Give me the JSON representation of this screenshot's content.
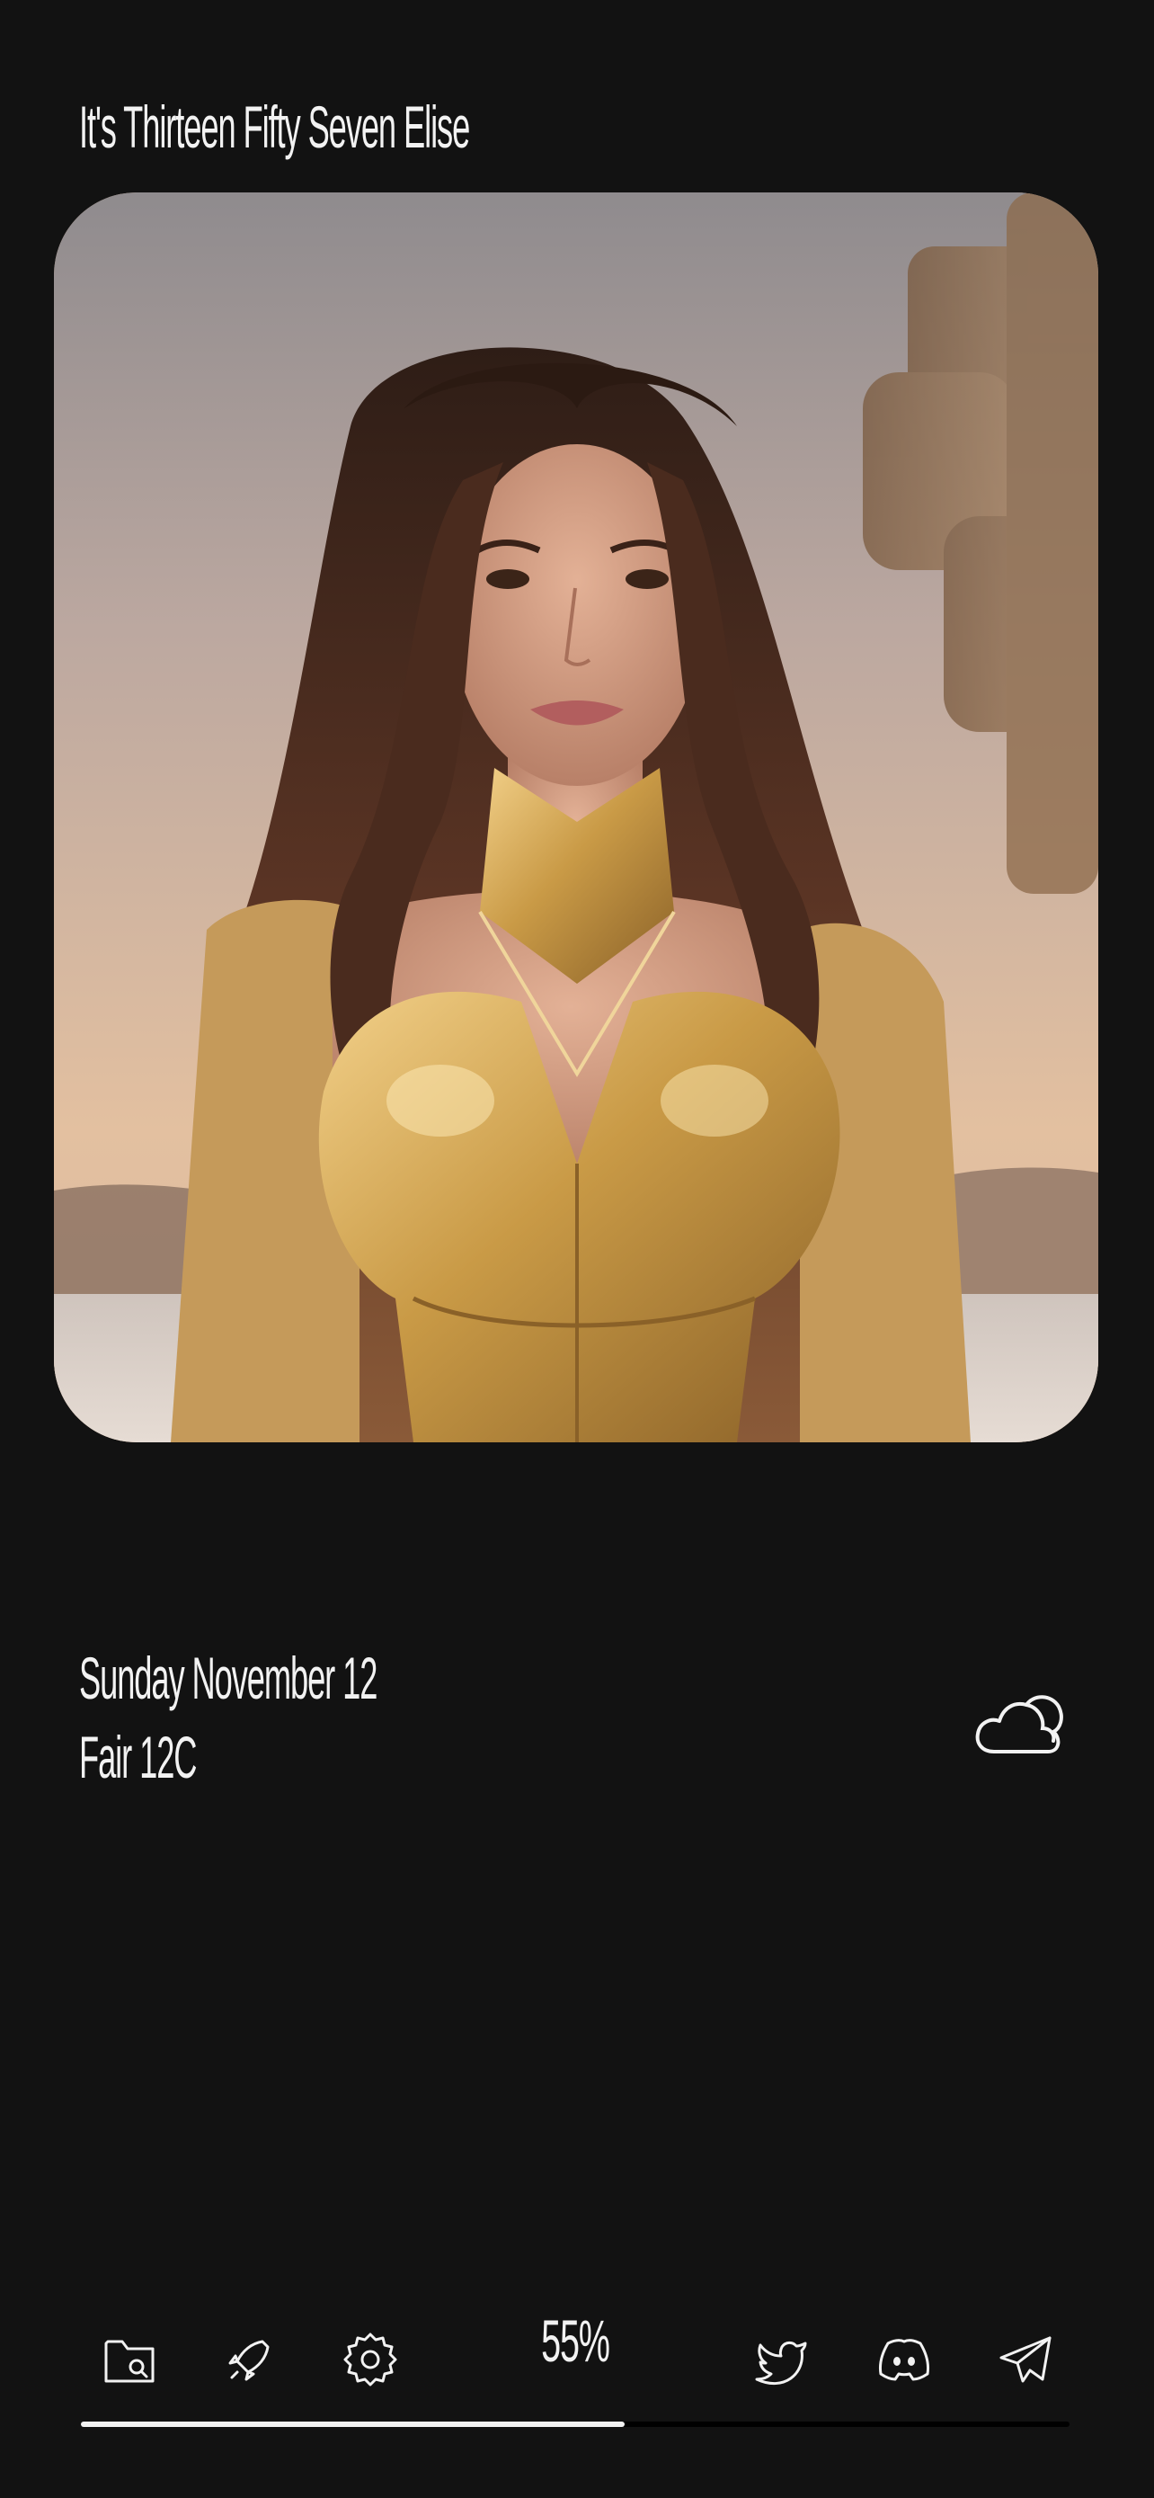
{
  "greeting": "It's Thirteen Fifty Seven Elise",
  "date_line": "Sunday November 12",
  "weather_line": "Fair 12C",
  "weather_icon": "cloud-icon",
  "battery": {
    "label": "55%",
    "level": 0.55
  },
  "dock": {
    "left_icons": [
      "folder-search-icon",
      "rocket-icon",
      "settings-gear-icon"
    ],
    "right_icons": [
      "twitter-bird-icon",
      "discord-icon",
      "telegram-icon"
    ]
  },
  "colors": {
    "background": "#121212",
    "foreground": "#f2f2f2",
    "track": "#000000"
  }
}
